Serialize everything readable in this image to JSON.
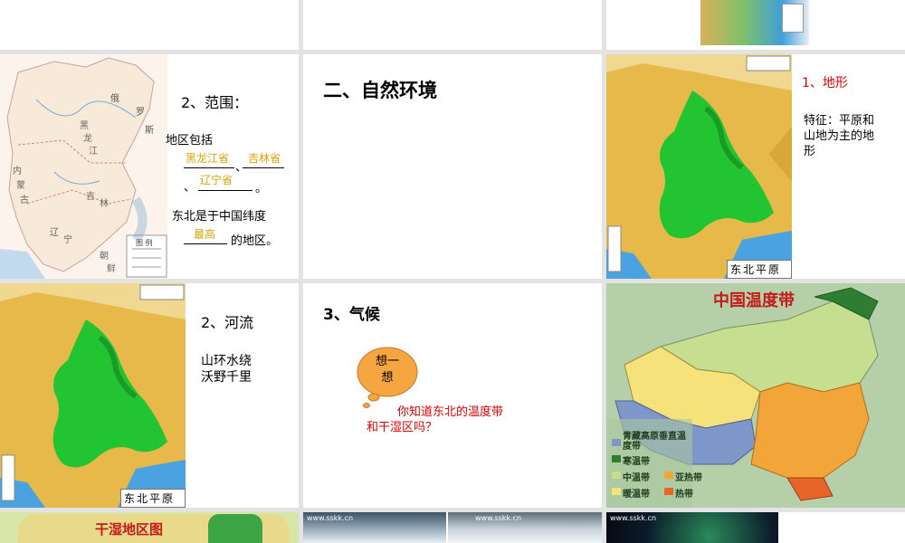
{
  "slides": {
    "range": {
      "heading": "2、范围：",
      "line1": "地区包括",
      "blank_hlj": "黑龙江省",
      "sep1": "、",
      "blank_jl": "吉林省",
      "sep2": "、",
      "blank_ln": "辽宁省",
      "period": "。",
      "line3": "东北是于中国纬度",
      "blank_lat": "最高",
      "line4": "的地区。",
      "map_labels": [
        "俄",
        "罗",
        "斯",
        "黑",
        "龙",
        "江",
        "吉",
        "林",
        "辽",
        "宁",
        "内",
        "蒙",
        "古",
        "朝",
        "鲜",
        "图 例"
      ]
    },
    "nature": {
      "heading": "二、自然环境"
    },
    "terrain": {
      "heading": "1、地形",
      "desc_line1": "特征：平原和",
      "desc_line2": "山地为主的地",
      "desc_line3": "形",
      "map_caption": "东北平原"
    },
    "rivers": {
      "heading": "2、河流",
      "line1": "山环水绕",
      "line2": "沃野千里",
      "map_caption": "东北平原"
    },
    "climate": {
      "heading": "3、气候",
      "cloud_text": "想一想",
      "q_line1": "你知道东北的温度带",
      "q_line2": "和干湿区吗？"
    },
    "temp_map": {
      "title": "中国温度带",
      "legend": [
        {
          "label": "青藏高原垂直温度带",
          "color": "#7f96c8"
        },
        {
          "label": "寒温带",
          "color": "#2e7d32"
        },
        {
          "label": "中温带",
          "color": "#c5de8f"
        },
        {
          "label": "亚热带",
          "color": "#f2a63a"
        },
        {
          "label": "暖温带",
          "color": "#f5e27a"
        },
        {
          "label": "热带",
          "color": "#e8652a"
        }
      ]
    },
    "bottom": {
      "dry_wet_title": "干湿地区图",
      "watermark1": "www.sskk.cn",
      "watermark2": "www.sskk.cn",
      "watermark3": "www.sskk.cn"
    }
  },
  "colors": {
    "plain_green": "#22c531",
    "upland": "#e8c24a",
    "sea": "#4aa3e0",
    "accent_red": "#e00000",
    "gold": "#d9a400"
  }
}
